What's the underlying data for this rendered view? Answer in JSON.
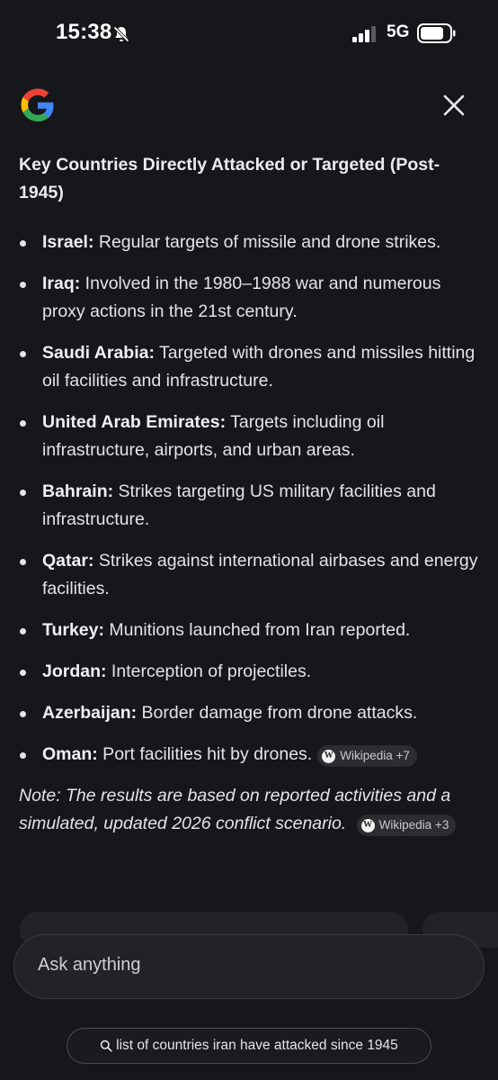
{
  "status_bar": {
    "time": "15:38",
    "network": "5G"
  },
  "header": {
    "logo_icon": "google-g-icon",
    "close_icon": "close-icon"
  },
  "answer": {
    "heading": "Key Countries Directly Attacked or Targeted (Post-1945)",
    "items": [
      {
        "country": "Israel:",
        "text": " Regular targets of missile and drone strikes."
      },
      {
        "country": "Iraq:",
        "text": " Involved in the 1980–1988 war and numerous proxy actions in the 21st century."
      },
      {
        "country": "Saudi Arabia:",
        "text": " Targeted with drones and missiles hitting oil facilities and infrastructure."
      },
      {
        "country": "United Arab Emirates:",
        "text": " Targets including oil infrastructure, airports, and urban areas."
      },
      {
        "country": "Bahrain:",
        "text": " Strikes targeting US military facilities and infrastructure."
      },
      {
        "country": "Qatar:",
        "text": " Strikes against international airbases and energy facilities."
      },
      {
        "country": "Turkey:",
        "text": " Munitions launched from Iran reported."
      },
      {
        "country": "Jordan:",
        "text": " Interception of projectiles."
      },
      {
        "country": "Azerbaijan:",
        "text": " Border damage from drone attacks."
      },
      {
        "country": "Oman:",
        "text": " Port facilities hit by drones."
      }
    ],
    "oman_source": {
      "label": "Wikipedia +7",
      "icon": "wikipedia-icon"
    },
    "note": "Note: The results are based on reported activities and a simulated, updated 2026 conflict scenario.",
    "note_source": {
      "label": "Wikipedia +3",
      "icon": "wikipedia-icon"
    }
  },
  "input": {
    "placeholder": "Ask anything"
  },
  "query_pill": {
    "text": "list of countries iran have attacked since 1945",
    "icon": "search-icon"
  },
  "colors": {
    "background": "#16171b",
    "surface": "#222327",
    "text": "#e4e4e6"
  }
}
